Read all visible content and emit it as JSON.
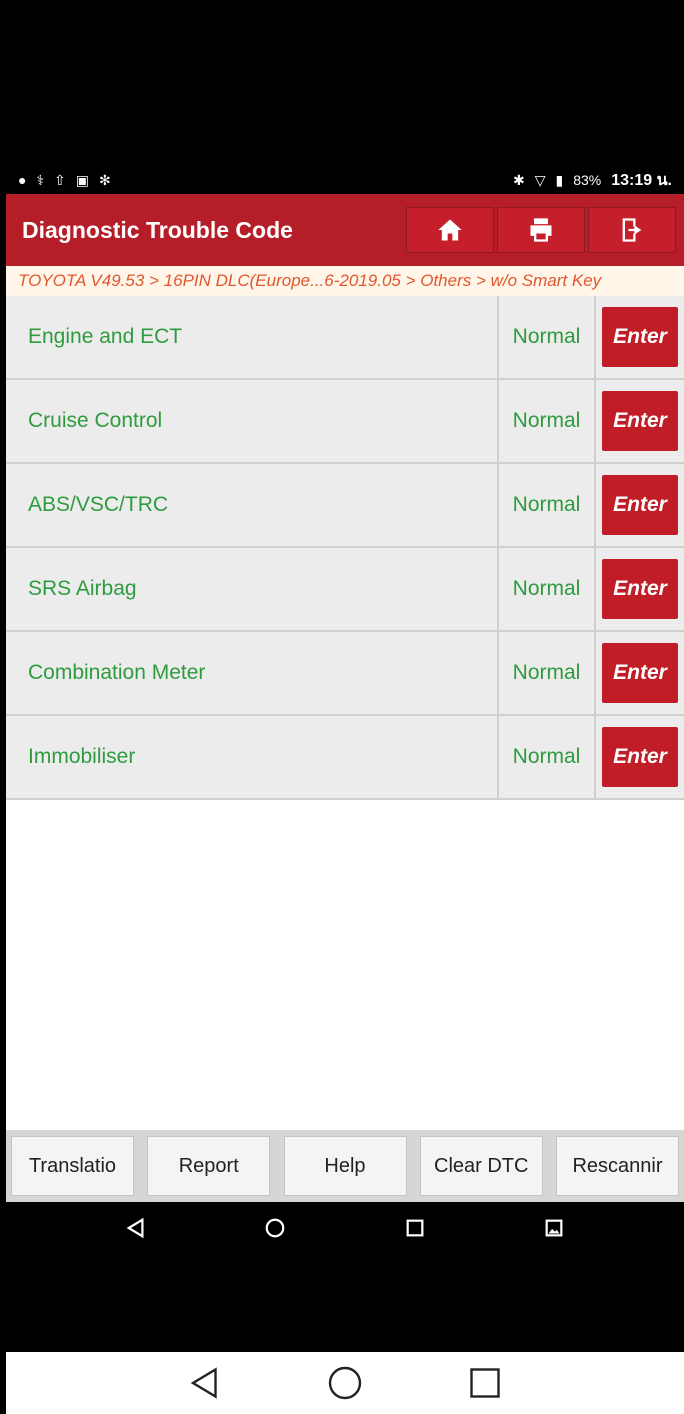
{
  "status_bar": {
    "battery": "83%",
    "time": "13:19 น."
  },
  "header": {
    "title": "Diagnostic Trouble Code",
    "home_icon": "home-icon",
    "print_icon": "print-icon",
    "exit_icon": "exit-icon"
  },
  "breadcrumb": "TOYOTA V49.53 > 16PIN DLC(Europe...6-2019.05 > Others > w/o Smart Key",
  "systems": [
    {
      "name": "Engine and ECT",
      "status": "Normal",
      "action": "Enter"
    },
    {
      "name": "Cruise Control",
      "status": "Normal",
      "action": "Enter"
    },
    {
      "name": "ABS/VSC/TRC",
      "status": "Normal",
      "action": "Enter"
    },
    {
      "name": "SRS Airbag",
      "status": "Normal",
      "action": "Enter"
    },
    {
      "name": "Combination Meter",
      "status": "Normal",
      "action": "Enter"
    },
    {
      "name": "Immobiliser",
      "status": "Normal",
      "action": "Enter"
    }
  ],
  "toolbar": {
    "translation": "Translatio",
    "report": "Report",
    "help": "Help",
    "clear_dtc": "Clear DTC",
    "rescan": "Rescannir"
  },
  "colors": {
    "header_red": "#b51e28",
    "text_green": "#2e9c3e",
    "breadcrumb_orange": "#e0572f"
  }
}
